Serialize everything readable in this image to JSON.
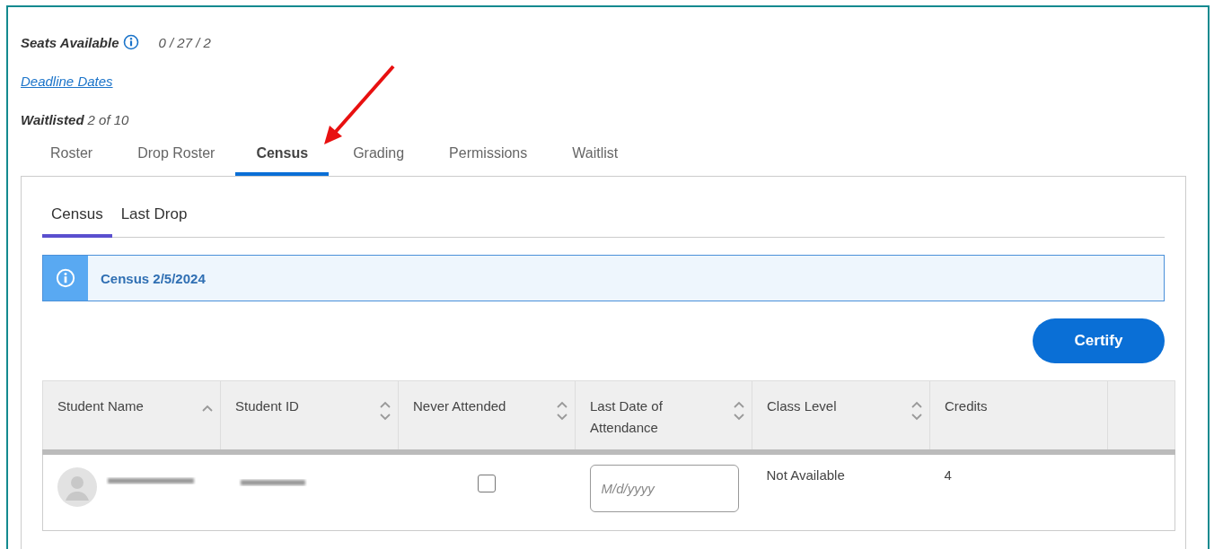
{
  "summary": {
    "seats_label": "Seats Available",
    "seats_value": "0 / 27 / 2",
    "deadline_link": "Deadline Dates",
    "waitlisted_label": "Waitlisted",
    "waitlisted_value": "2 of 10"
  },
  "tabs": [
    {
      "label": "Roster",
      "selected": false
    },
    {
      "label": "Drop Roster",
      "selected": false
    },
    {
      "label": "Census",
      "selected": true
    },
    {
      "label": "Grading",
      "selected": false
    },
    {
      "label": "Permissions",
      "selected": false
    },
    {
      "label": "Waitlist",
      "selected": false
    }
  ],
  "subtabs": [
    {
      "label": "Census",
      "selected": true
    },
    {
      "label": "Last Drop",
      "selected": false
    }
  ],
  "banner": {
    "text": "Census 2/5/2024"
  },
  "certify_button": "Certify",
  "table": {
    "columns": [
      {
        "label": "Student Name",
        "kind": "sorted"
      },
      {
        "label": "Student ID",
        "kind": "sortable"
      },
      {
        "label": "Never Attended",
        "kind": "sortable"
      },
      {
        "label": "Last Date of Attendance",
        "kind": "sortable"
      },
      {
        "label": "Class Level",
        "kind": "sortable"
      },
      {
        "label": "Credits",
        "kind": "plain"
      }
    ],
    "rows": [
      {
        "never_attended": false,
        "date_placeholder": "M/d/yyyy",
        "class_level": "Not Available",
        "credits": "4"
      }
    ]
  }
}
